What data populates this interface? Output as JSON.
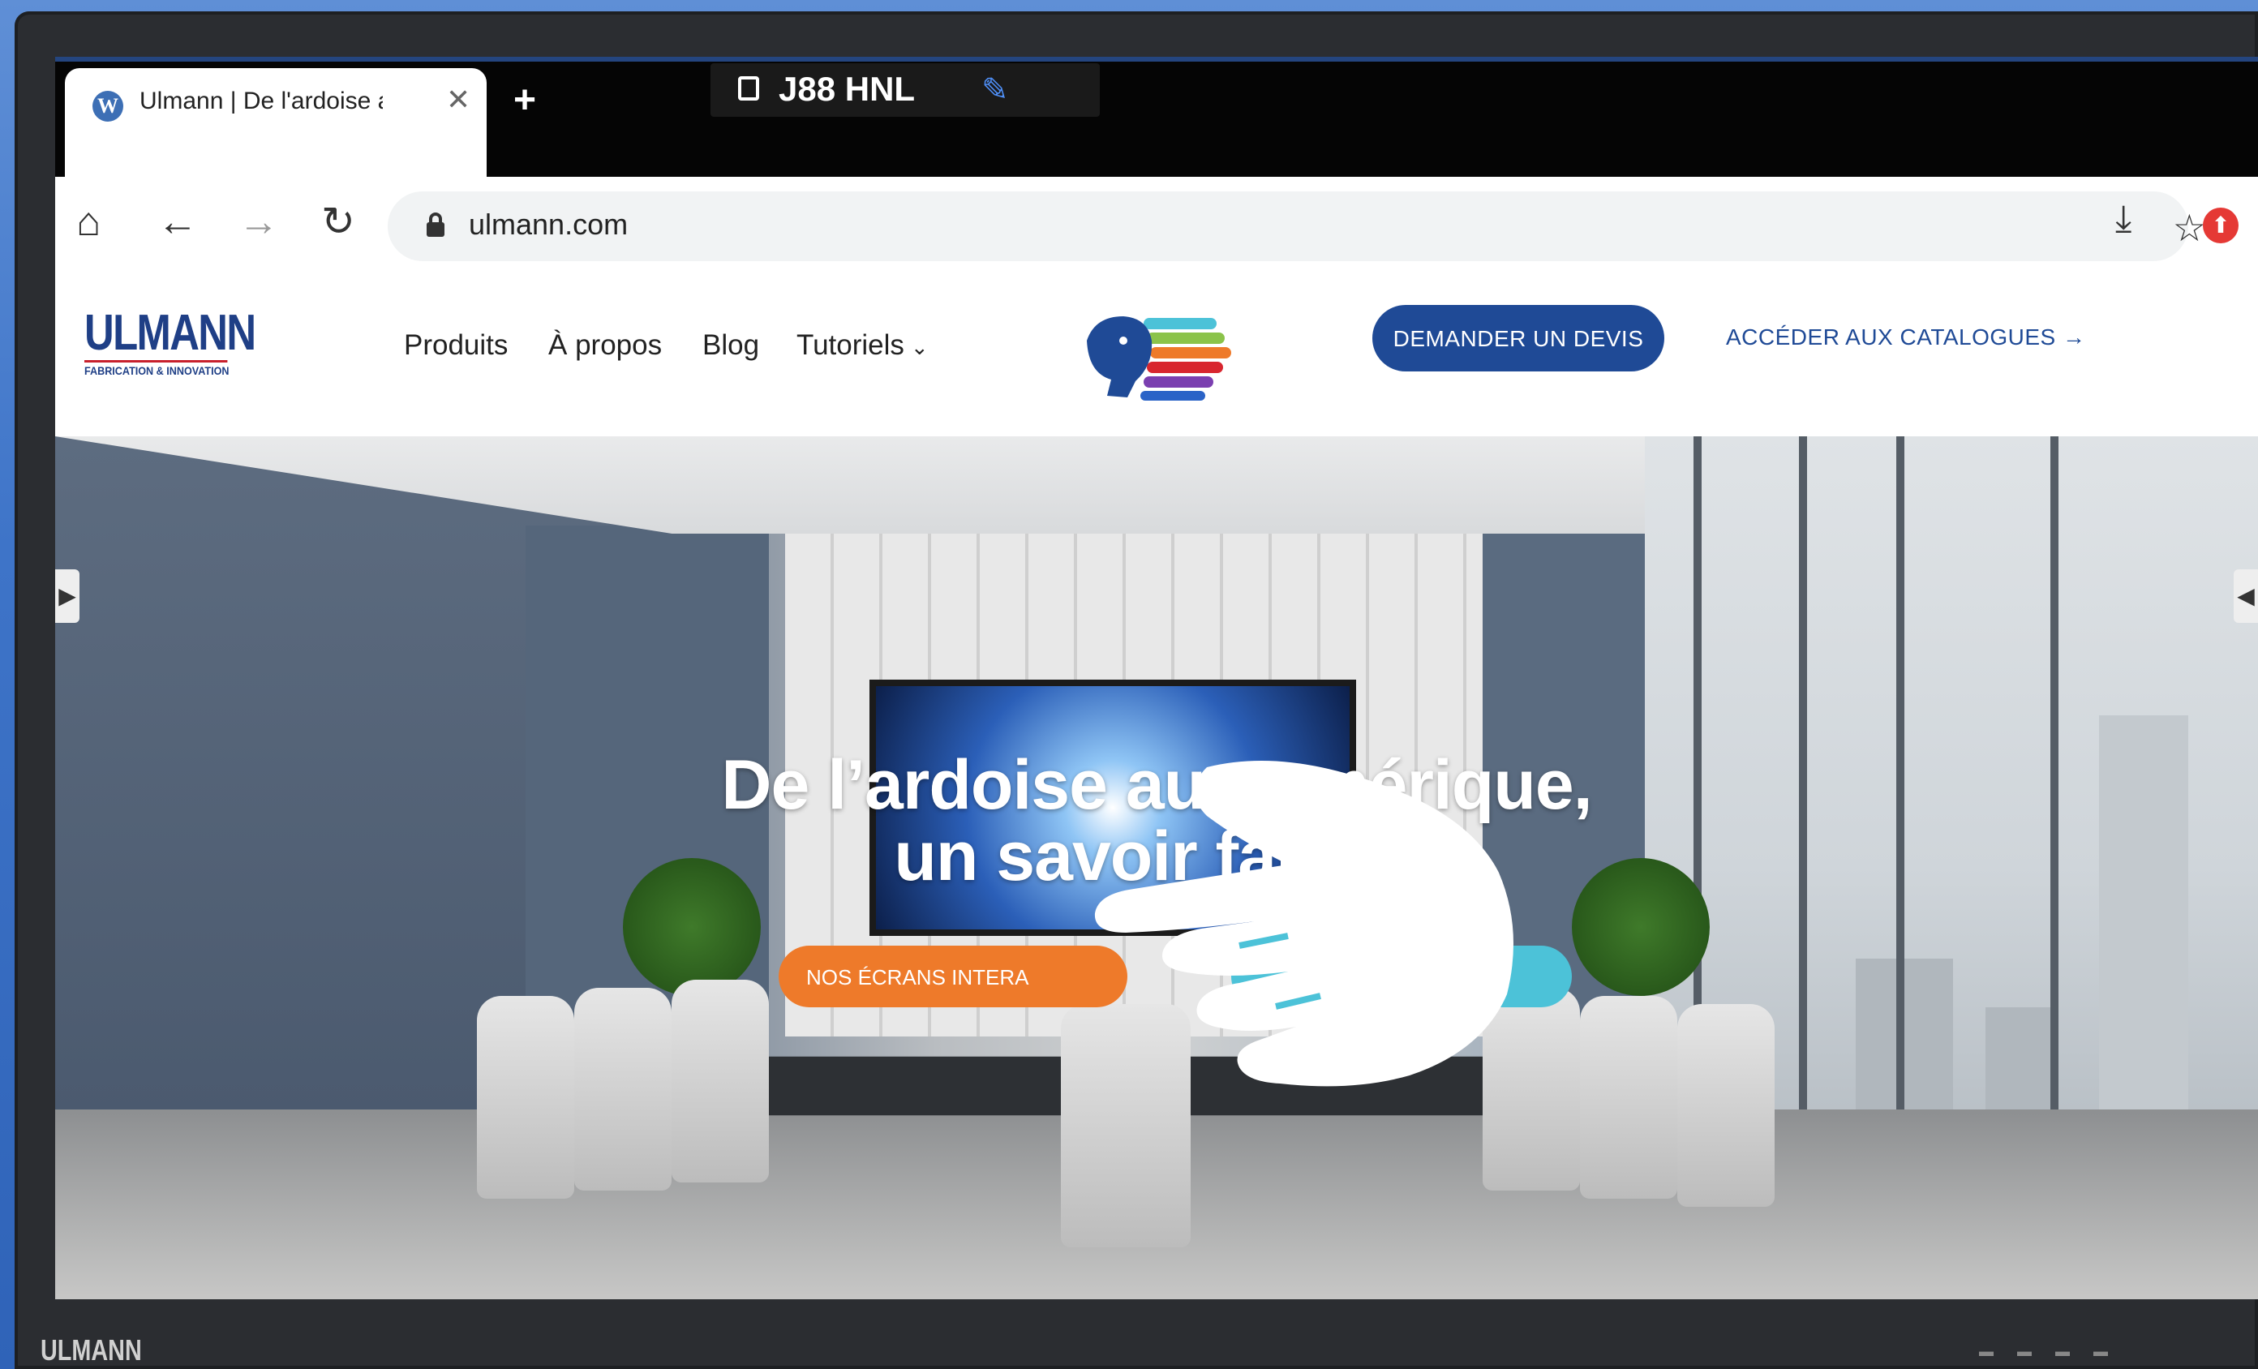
{
  "browser": {
    "tab": {
      "title": "Ulmann | De l'ardoise au num",
      "favicon": "wordpress-icon"
    },
    "new_tab_label": "+",
    "share": {
      "code": "J88 HNL",
      "icon": "cast-icon",
      "pen_icon": "pen-icon"
    },
    "toolbar": {
      "home_icon": "home-icon",
      "back_icon": "back-arrow-icon",
      "forward_icon": "forward-arrow-icon",
      "reload_icon": "reload-icon",
      "url": "ulmann.com",
      "bookmark_icon": "star-icon",
      "download_icon": "download-icon",
      "extension_icon": "extension-icon"
    }
  },
  "site": {
    "logo": {
      "word": "ULMANN",
      "tagline": "FABRICATION & INNOVATION"
    },
    "nav": [
      {
        "label": "Produits"
      },
      {
        "label": "À propos"
      },
      {
        "label": "Blog"
      },
      {
        "label": "Tutoriels"
      }
    ],
    "cta_devis": "DEMANDER UN DEVIS",
    "cta_catalogues": "ACCÉDER AUX CATALOGUES →",
    "hero": {
      "title_line1": "De l’ardoise au numérique,",
      "title_line2": "un savoir faire u",
      "primary_button": "NOS ÉCRANS INTERA"
    }
  },
  "device": {
    "brand": "ULMANN"
  },
  "colors": {
    "brand_blue": "#1f4a96",
    "orange": "#ee7a2a",
    "teal": "#4cc2d8"
  }
}
